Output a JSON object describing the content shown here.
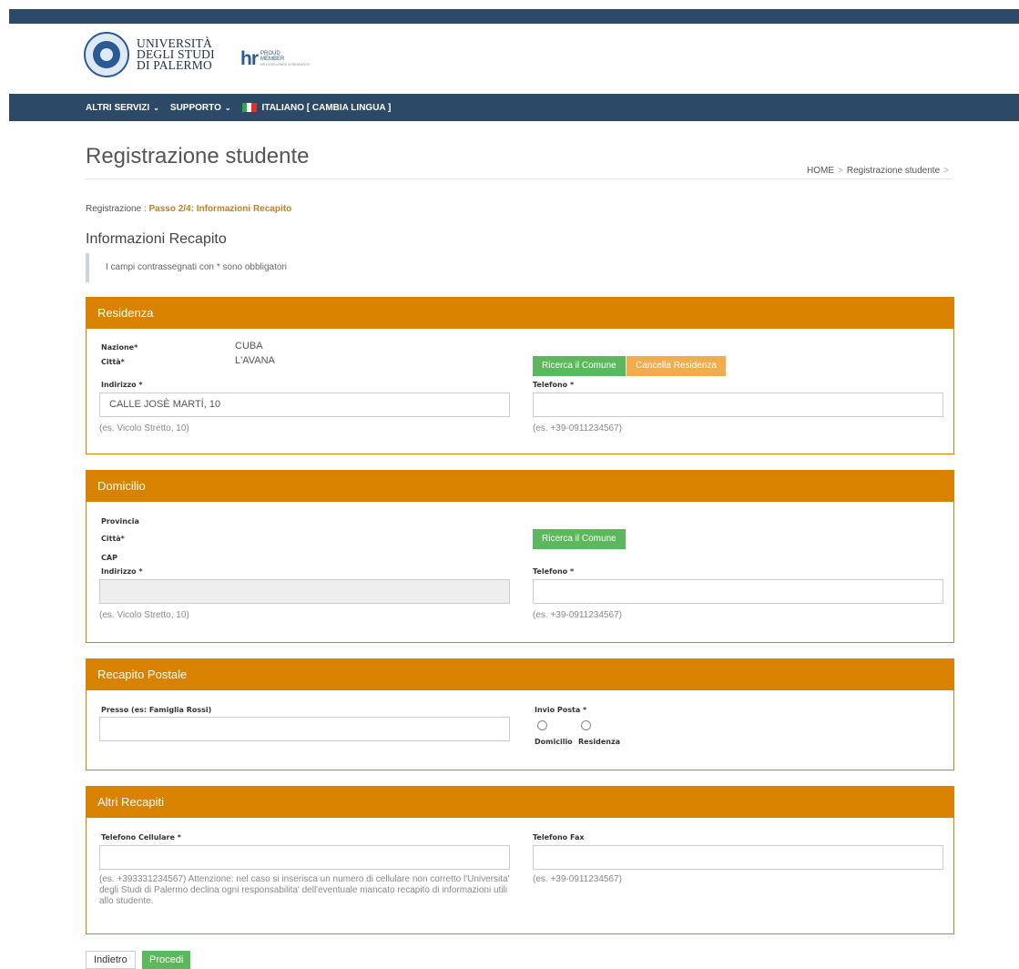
{
  "header": {
    "university_line1": "UNIVERSITÀ",
    "university_line2": "DEGLI STUDI",
    "university_line3": "DI PALERMO",
    "hr_mark": "hr",
    "hr_line1": "PROUD",
    "hr_line2": "MEMBER",
    "hr_line3": "HR EXCELLENCE IN RESEARCH"
  },
  "nav": {
    "altri_servizi": "ALTRI SERVIZI",
    "supporto": "SUPPORTO",
    "lingua": "ITALIANO [ CAMBIA LINGUA ]",
    "flag_colors": [
      "#3aa24b",
      "#ffffff",
      "#d9342b"
    ]
  },
  "page": {
    "title": "Registrazione studente",
    "breadcrumb": [
      "HOME",
      "Registrazione studente"
    ],
    "step_prefix": "Registrazione :",
    "step_label": "Passo 2/4: Informazioni Recapito",
    "section_title": "Informazioni Recapito",
    "note": "I campi contrassegnati con * sono obbligatori"
  },
  "residenza": {
    "title": "Residenza",
    "nazione_label": "Nazione*",
    "nazione_value": "CUBA",
    "citta_label": "Città*",
    "citta_value": "L'AVANA",
    "ricerca_button": "Ricerca il Comune",
    "cancella_button": "Cancella Residenza",
    "indirizzo_label": "Indirizzo *",
    "indirizzo_value": "CALLE JOSÈ MARTÍ, 10",
    "indirizzo_hint": "(es. Vicolo Stretto, 10)",
    "telefono_label": "Telefono *",
    "telefono_value": "",
    "telefono_hint": "(es. +39-0911234567)"
  },
  "domicilio": {
    "title": "Domicilio",
    "provincia_label": "Provincia",
    "citta_label": "Città*",
    "cap_label": "CAP",
    "ricerca_button": "Ricerca il Comune",
    "indirizzo_label": "Indirizzo *",
    "indirizzo_value": "",
    "indirizzo_hint": "(es. Vicolo Stretto, 10)",
    "telefono_label": "Telefono *",
    "telefono_value": "",
    "telefono_hint": "(es. +39-0911234567)"
  },
  "postale": {
    "title": "Recapito Postale",
    "presso_label": "Presso (es: Famiglia Rossi)",
    "presso_value": "",
    "invio_label": "Invio Posta *",
    "option_domicilio": "Domicilio",
    "option_residenza": "Residenza"
  },
  "altri": {
    "title": "Altri Recapiti",
    "cellulare_label": "Telefono Cellulare *",
    "cellulare_value": "",
    "cellulare_hint": "(es. +393331234567) Attenzione: nel caso si inserisca un numero di cellulare non corretto l'Universita' degli Studi di Palermo declina ogni responsabilita' dell'eventuale mancato recapito di informazioni utili allo studente.",
    "fax_label": "Telefono Fax",
    "fax_value": "",
    "fax_hint": "(es. +39-0911234567)"
  },
  "actions": {
    "indietro": "Indietro",
    "procedi": "Procedi"
  },
  "colors": {
    "navbar": "#2c4a67",
    "panel": "#d88200",
    "success": "#5cb85c",
    "warning": "#f0ad4e",
    "step": "#c77e1d"
  }
}
